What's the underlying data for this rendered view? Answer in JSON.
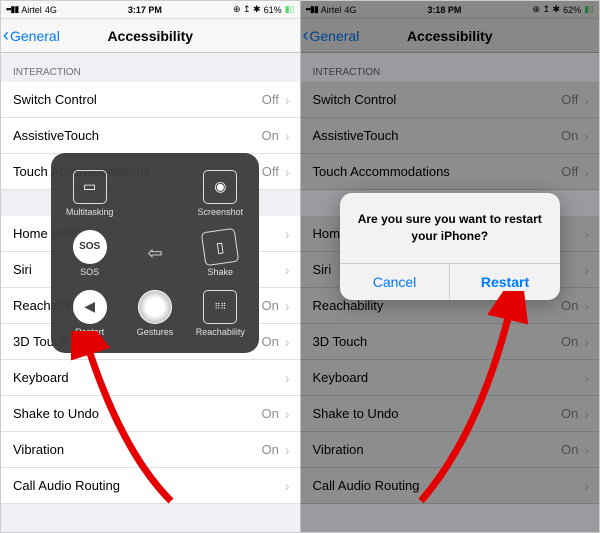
{
  "left": {
    "status": {
      "carrier": "Airtel",
      "network": "4G",
      "time": "3:17 PM",
      "battery": "61%"
    },
    "nav": {
      "back": "General",
      "title": "Accessibility"
    },
    "section": "INTERACTION",
    "rows1": [
      {
        "label": "Switch Control",
        "value": "Off"
      },
      {
        "label": "AssistiveTouch",
        "value": "On"
      },
      {
        "label": "Touch Accommodations",
        "value": "Off"
      }
    ],
    "rows2": [
      {
        "label": "Home Button",
        "value": ""
      },
      {
        "label": "Siri",
        "value": ""
      },
      {
        "label": "Reachability",
        "value": "On"
      },
      {
        "label": "3D Touch",
        "value": "On"
      },
      {
        "label": "Keyboard",
        "value": ""
      },
      {
        "label": "Shake to Undo",
        "value": "On"
      },
      {
        "label": "Vibration",
        "value": "On"
      },
      {
        "label": "Call Audio Routing",
        "value": ""
      }
    ],
    "at_menu": {
      "items": [
        {
          "name": "multitasking",
          "label": "Multitasking"
        },
        {
          "name": "empty",
          "label": ""
        },
        {
          "name": "screenshot",
          "label": "Screenshot"
        },
        {
          "name": "sos",
          "label": "SOS"
        },
        {
          "name": "back",
          "label": ""
        },
        {
          "name": "shake",
          "label": "Shake"
        },
        {
          "name": "restart",
          "label": "Restart"
        },
        {
          "name": "gestures",
          "label": "Gestures"
        },
        {
          "name": "reachability",
          "label": "Reachability"
        }
      ]
    }
  },
  "right": {
    "status": {
      "carrier": "Airtel",
      "network": "4G",
      "time": "3:18 PM",
      "battery": "62%"
    },
    "nav": {
      "back": "General",
      "title": "Accessibility"
    },
    "section": "INTERACTION",
    "rows1": [
      {
        "label": "Switch Control",
        "value": "Off"
      },
      {
        "label": "AssistiveTouch",
        "value": "On"
      },
      {
        "label": "Touch Accommodations",
        "value": "Off"
      }
    ],
    "rows2_labels": [
      "Home Button",
      "Siri",
      "Reachability",
      "3D Touch",
      "Keyboard",
      "Shake to Undo",
      "Vibration",
      "Call Audio Routing"
    ],
    "rows2_values": [
      "",
      "",
      "On",
      "On",
      "",
      "On",
      "On",
      ""
    ],
    "alert": {
      "message": "Are you sure you want to restart your iPhone?",
      "cancel": "Cancel",
      "confirm": "Restart"
    }
  }
}
